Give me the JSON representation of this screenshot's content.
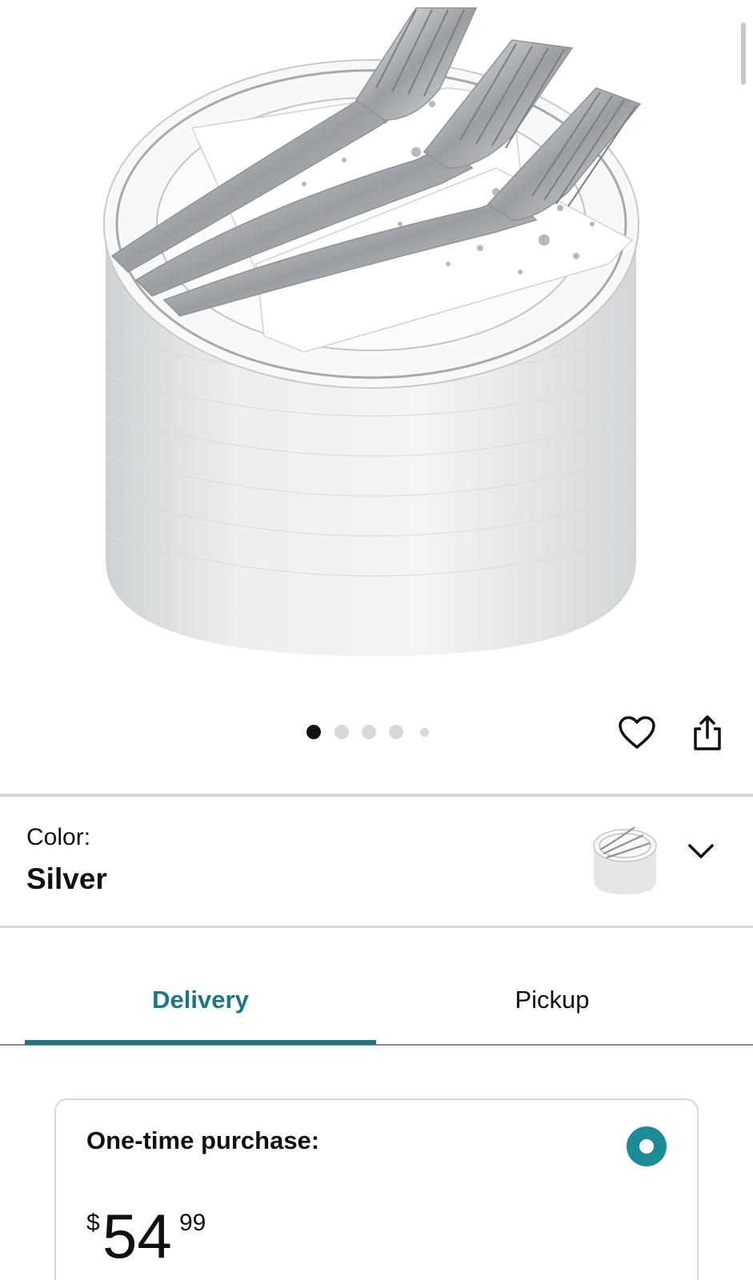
{
  "product": {
    "image_alt": "Silver rim plastic plates with silver forks and dotted napkins",
    "image_count": 5,
    "active_image_index": 0
  },
  "actions": {
    "wishlist_icon": "heart-icon",
    "share_icon": "share-icon"
  },
  "variation": {
    "label": "Color:",
    "value": "Silver",
    "expand_icon": "chevron-down-icon"
  },
  "tabs": [
    {
      "label": "Delivery",
      "active": true
    },
    {
      "label": "Pickup",
      "active": false
    }
  ],
  "purchase": {
    "option_title": "One-time purchase:",
    "selected": true,
    "price": {
      "symbol": "$",
      "whole": "54",
      "fraction": "99"
    }
  },
  "colors": {
    "accent": "#1d7483",
    "radio": "#1d8b96",
    "text": "#0f1111",
    "divider": "#d5dbdb"
  }
}
